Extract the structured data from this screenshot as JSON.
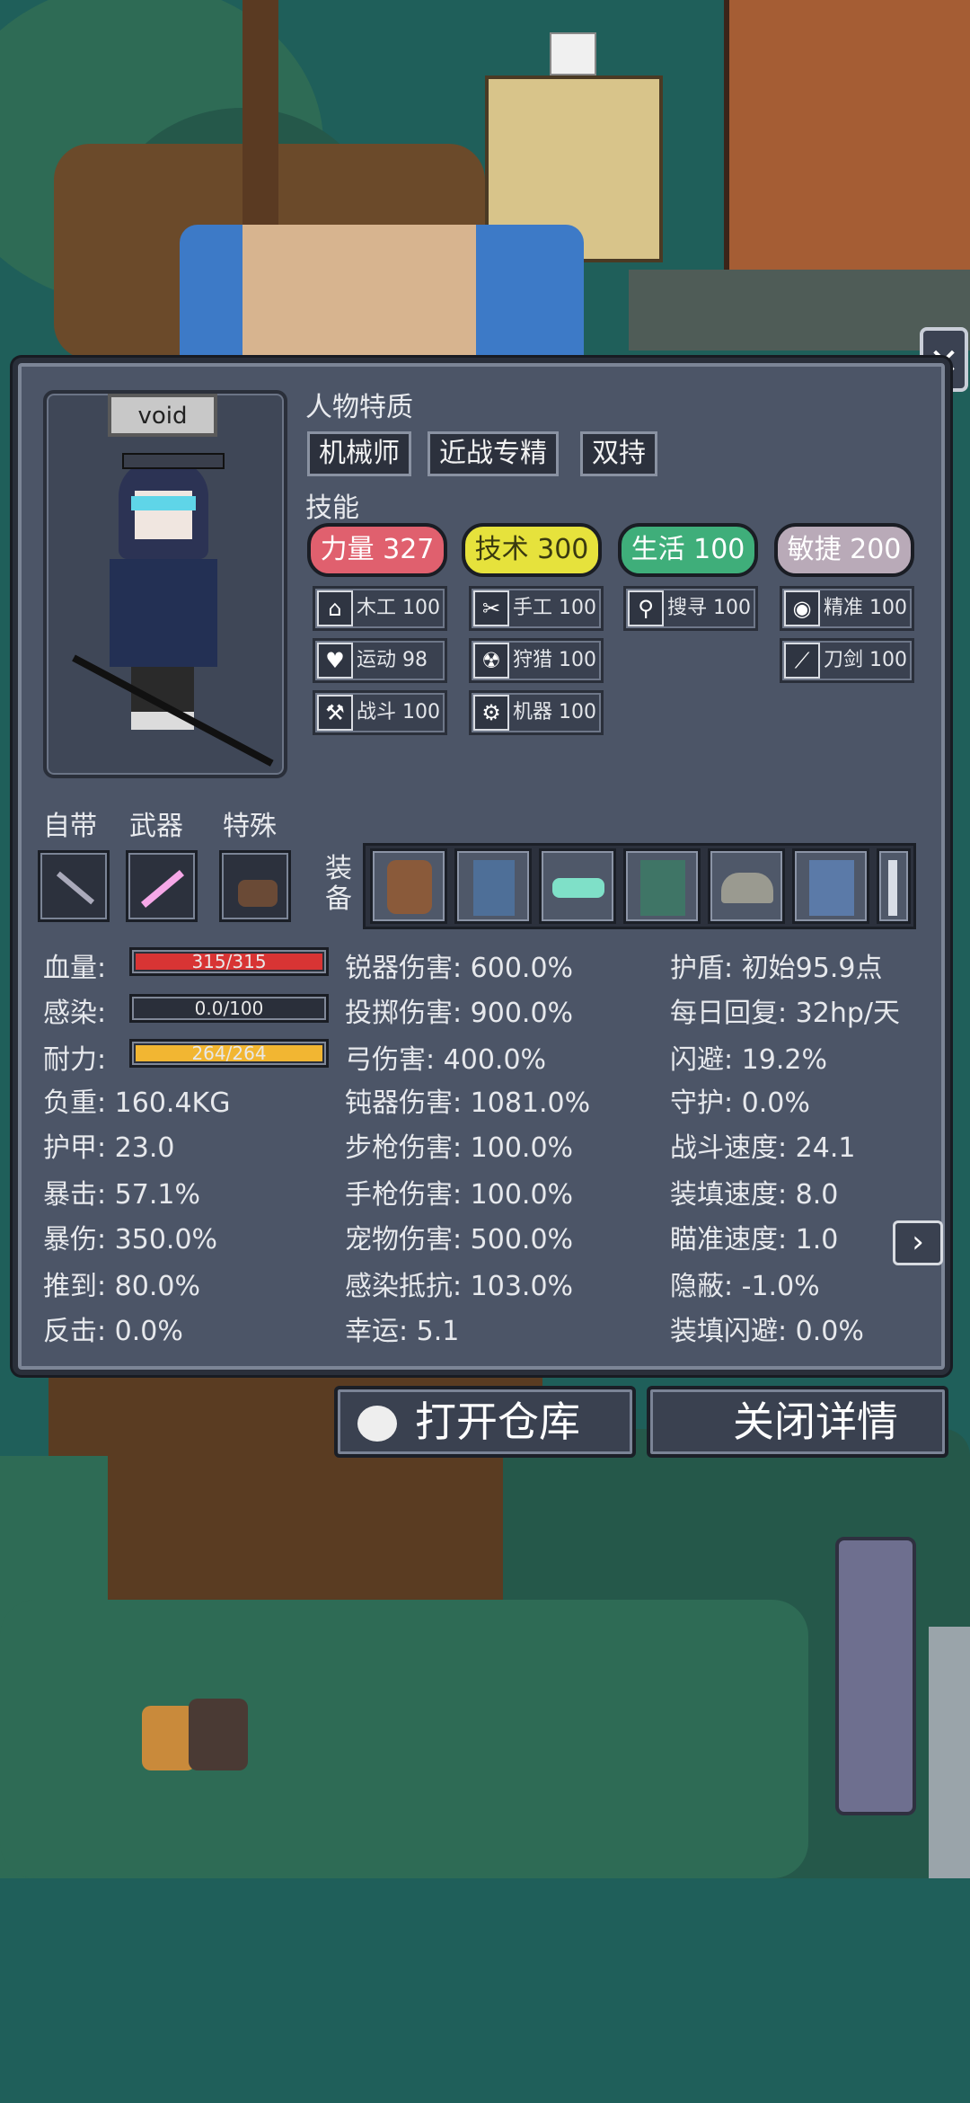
{
  "character": {
    "name": "void"
  },
  "traits": {
    "header": "人物特质",
    "items": [
      "机械师",
      "近战专精",
      "双持"
    ]
  },
  "skills": {
    "header": "技能",
    "groups": [
      {
        "label": "力量 327",
        "color": "#e0606e",
        "text_color": "#ffffff"
      },
      {
        "label": "技术 300",
        "color": "#e6e23c",
        "text_color": "#3a3a10"
      },
      {
        "label": "生活 100",
        "color": "#3fae7a",
        "text_color": "#ffffff"
      },
      {
        "label": "敏捷 200",
        "color": "#b9aab8",
        "text_color": "#ffffff"
      }
    ],
    "sub": [
      {
        "icon": "house-icon",
        "glyph": "⌂",
        "label": "木工 100"
      },
      {
        "icon": "heart-icon",
        "glyph": "♥",
        "label": "运动 98"
      },
      {
        "icon": "wrench-icon",
        "glyph": "⚒",
        "label": "战斗 100"
      },
      {
        "icon": "scissors-icon",
        "glyph": "✂",
        "label": "手工 100"
      },
      {
        "icon": "radiation-icon",
        "glyph": "☢",
        "label": "狩猎 100"
      },
      {
        "icon": "gear-icon",
        "glyph": "⚙",
        "label": "机器 100"
      },
      {
        "icon": "magnifier-icon",
        "glyph": "⚲",
        "label": "搜寻 100"
      },
      {
        "icon": "eye-icon",
        "glyph": "◉",
        "label": "精准 100"
      },
      {
        "icon": "sword-icon",
        "glyph": "⟋",
        "label": "刀剑 100"
      }
    ]
  },
  "loadout": {
    "tabs": [
      "自带",
      "武器",
      "特殊"
    ],
    "equipment_label": "装备"
  },
  "stats_left": {
    "hp_label": "血量:",
    "hp_value": "315/315",
    "hp_fraction": 1.0,
    "infection_label": "感染:",
    "infection_value": "0.0/100",
    "infection_fraction": 0.0,
    "stamina_label": "耐力:",
    "stamina_value": "264/264",
    "stamina_fraction": 1.0,
    "rows": [
      "负重:  160.4KG",
      "护甲:  23.0",
      "暴击:  57.1%",
      "暴伤:  350.0%",
      "推到:  80.0%",
      "反击:  0.0%"
    ]
  },
  "stats_mid": [
    "锐器伤害:  600.0%",
    "投掷伤害:  900.0%",
    "弓伤害:  400.0%",
    "钝器伤害:  1081.0%",
    "步枪伤害:  100.0%",
    "手枪伤害:  100.0%",
    "宠物伤害:  500.0%",
    "感染抵抗:  103.0%",
    "幸运:  5.1"
  ],
  "stats_right": [
    "护盾:  初始95.9点",
    "每日回复:  32hp/天",
    "闪避:  19.2%",
    "守护:  0.0%",
    "战斗速度:  24.1",
    "装填速度:  8.0",
    "瞄准速度:  1.0",
    "隐蔽:  -1.0%",
    "装填闪避:  0.0%"
  ],
  "buttons": {
    "open_storage": "打开仓库",
    "close_details": "关闭详情",
    "close_glyph": "✕",
    "next_glyph": "›"
  }
}
